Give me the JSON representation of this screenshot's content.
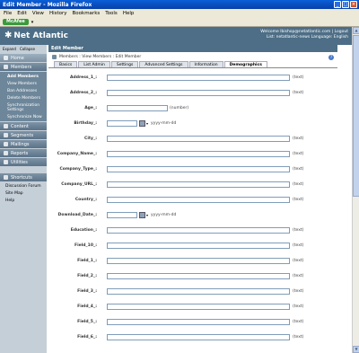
{
  "window": {
    "title": "Edit Member - Mozilla Firefox",
    "minimize": "_",
    "maximize": "□",
    "close": "×"
  },
  "menu": [
    "File",
    "Edit",
    "View",
    "History",
    "Bookmarks",
    "Tools",
    "Help"
  ],
  "toolbar": {
    "mcafee_label": "McAfee",
    "mcafee_dropdown": "▾"
  },
  "header": {
    "logo_text": "Net Atlantic",
    "welcome": "Welcome lbishop@netatlantic.com | Logout",
    "list_info": "List: netatlantic-news  Language: English"
  },
  "sidebar": {
    "expand": "Expand",
    "collapse": "Collapse",
    "home": "Home",
    "members": "Members",
    "members_sub": [
      "Add Members",
      "View Members",
      "Ban Addresses",
      "Delete Members",
      "Synchronization Settings",
      "Synchronize Now"
    ],
    "sections": [
      "Content",
      "Segments",
      "Mailings",
      "Reports",
      "Utilities"
    ],
    "shortcuts": "Shortcuts",
    "shortcut_items": [
      "Discussion Forum",
      "Site Map",
      "Help"
    ]
  },
  "main": {
    "title": "Edit Member",
    "breadcrumb": "Members : View Members : Edit Member",
    "help": "?",
    "tabs": [
      "Basics",
      "List Admin",
      "Settings",
      "Advanced Settings",
      "Information",
      "Demographics"
    ],
    "active_tab": "Demographics"
  },
  "form": {
    "rows": [
      {
        "label": "Address_1_:",
        "type": "text",
        "hint": "(text)"
      },
      {
        "label": "Address_2_:",
        "type": "text",
        "hint": "(text)"
      },
      {
        "label": "Age_:",
        "type": "short",
        "hint": "(number)"
      },
      {
        "label": "Birthday_:",
        "type": "date",
        "hint": "yyyy-mm-dd"
      },
      {
        "label": "City_:",
        "type": "text",
        "hint": "(text)"
      },
      {
        "label": "Company_Name_:",
        "type": "text",
        "hint": "(text)"
      },
      {
        "label": "Company_Type_:",
        "type": "text",
        "hint": "(text)"
      },
      {
        "label": "Company_URL_:",
        "type": "text",
        "hint": "(text)"
      },
      {
        "label": "Country_:",
        "type": "text",
        "hint": "(text)"
      },
      {
        "label": "Download_Date_:",
        "type": "date",
        "hint": "yyyy-mm-dd"
      },
      {
        "label": "Education_:",
        "type": "text",
        "hint": "(text)"
      },
      {
        "label": "Field_10_:",
        "type": "text",
        "hint": "(text)"
      },
      {
        "label": "Field_1_:",
        "type": "text",
        "hint": "(text)"
      },
      {
        "label": "Field_2_:",
        "type": "text",
        "hint": "(text)"
      },
      {
        "label": "Field_3_:",
        "type": "text",
        "hint": "(text)"
      },
      {
        "label": "Field_4_:",
        "type": "text",
        "hint": "(text)"
      },
      {
        "label": "Field_5_:",
        "type": "text",
        "hint": "(text)"
      },
      {
        "label": "Field_6_:",
        "type": "text",
        "hint": "(text)"
      }
    ]
  }
}
